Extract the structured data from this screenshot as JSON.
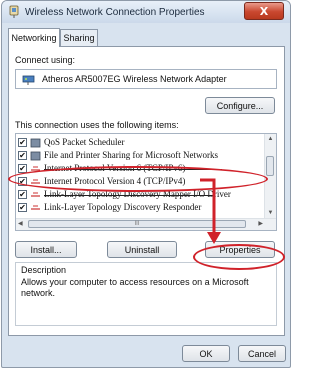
{
  "window": {
    "title": "Wireless Network Connection Properties",
    "close_label": "X"
  },
  "tabs": [
    {
      "label": "Networking",
      "active": true
    },
    {
      "label": "Sharing",
      "active": false
    }
  ],
  "connect_using": {
    "label": "Connect using:",
    "adapter_name": "Atheros AR5007EG Wireless Network Adapter",
    "adapter_icon": "network-adapter-icon"
  },
  "configure_button": "Configure...",
  "items_label": "This connection uses the following items:",
  "items": [
    {
      "label": "QoS Packet Scheduler",
      "checked": true,
      "icon": "service-icon"
    },
    {
      "label": "File and Printer Sharing for Microsoft Networks",
      "checked": true,
      "icon": "service-icon"
    },
    {
      "label": "Internet Protocol Version 6 (TCP/IPv6)",
      "checked": true,
      "icon": "protocol-icon"
    },
    {
      "label": "Internet Protocol Version 4 (TCP/IPv4)",
      "checked": true,
      "icon": "protocol-icon",
      "selected": true
    },
    {
      "label": "Link-Layer Topology Discovery Mapper I/O Driver",
      "checked": true,
      "icon": "protocol-icon"
    },
    {
      "label": "Link-Layer Topology Discovery Responder",
      "checked": true,
      "icon": "protocol-icon"
    }
  ],
  "hscroll_thumb_label": "III",
  "buttons": {
    "install": "Install...",
    "uninstall": "Uninstall",
    "properties": "Properties",
    "ok": "OK",
    "cancel": "Cancel"
  },
  "description": {
    "title": "Description",
    "text": "Allows your computer to access resources on a Microsoft network."
  },
  "colors": {
    "annotation": "#d0222a",
    "titlebar": "#cbd9ea",
    "close_button": "#c9472f"
  }
}
